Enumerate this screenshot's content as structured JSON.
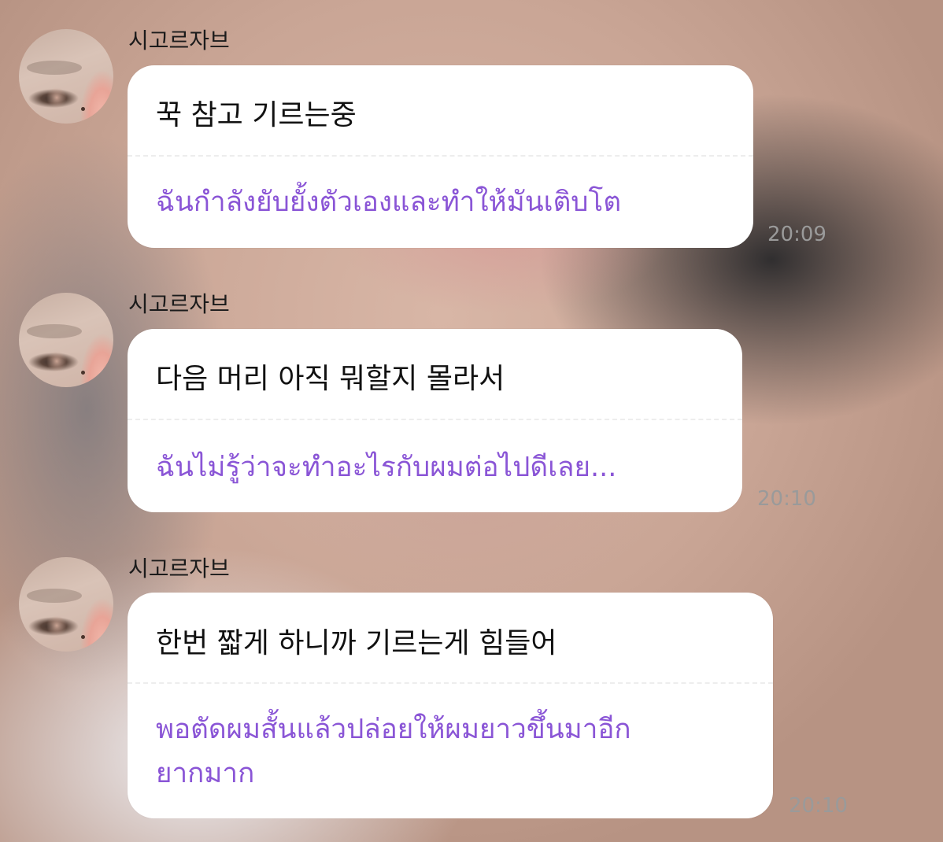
{
  "messages": [
    {
      "sender": "시고르자브",
      "korean": "꾹 참고 기르는중",
      "thai": "ฉันกำลังยับยั้งตัวเองและทำให้มันเติบโต",
      "time": "20:09"
    },
    {
      "sender": "시고르자브",
      "korean": "다음 머리 아직 뭐할지 몰라서",
      "thai": "ฉันไม่รู้ว่าจะทำอะไรกับผมต่อไปดีเลย...",
      "time": "20:10"
    },
    {
      "sender": "시고르자브",
      "korean": "한번 짧게 하니까 기르는게 힘들어",
      "thai": "พอตัดผมสั้นแล้วปล่อยให้ผมยาวขึ้นมาอีก\nยากมาก",
      "time": "20:10"
    }
  ],
  "colors": {
    "translation_text": "#8a55d6",
    "bubble": "#ffffff",
    "timestamp": "#9a9a9a"
  },
  "icons": {
    "avatar": "profile-photo-avatar"
  }
}
